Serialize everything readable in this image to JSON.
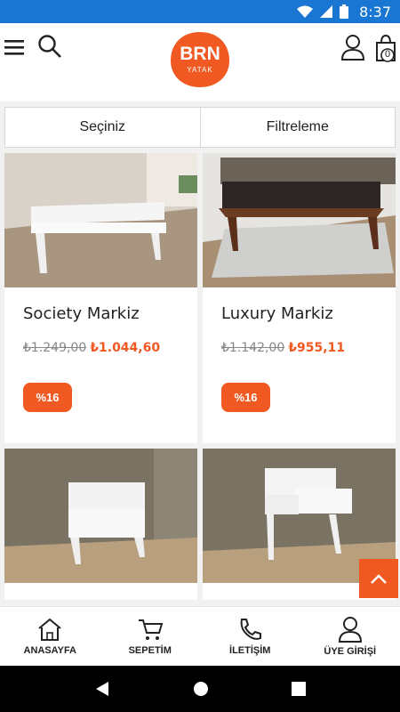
{
  "status": {
    "time": "8:37"
  },
  "header": {
    "logo_main": "BRN",
    "logo_sub": "YATAK",
    "cart_count": "0"
  },
  "filters": {
    "select_label": "Seçiniz",
    "filter_label": "Filtreleme"
  },
  "products": [
    {
      "name": "Society Markiz",
      "old_price": "₺1.249,00",
      "new_price": "₺1.044,60",
      "discount": "%16"
    },
    {
      "name": "Luxury Markiz",
      "old_price": "₺1.142,00",
      "new_price": "₺955,11",
      "discount": "%16"
    },
    {
      "name": "",
      "old_price": "",
      "new_price": "",
      "discount": ""
    },
    {
      "name": "",
      "old_price": "",
      "new_price": "",
      "discount": ""
    }
  ],
  "bottom_nav": [
    {
      "label": "ANASAYFA",
      "icon": "home-icon"
    },
    {
      "label": "SEPETİM",
      "icon": "cart-icon"
    },
    {
      "label": "İLETİŞİM",
      "icon": "phone-icon"
    },
    {
      "label": "ÜYE GİRİŞİ",
      "icon": "user-icon"
    }
  ],
  "colors": {
    "accent": "#f05a22",
    "statusbar": "#1976d2"
  }
}
